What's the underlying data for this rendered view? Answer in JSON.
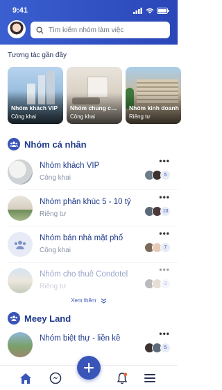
{
  "status": {
    "time": "9:41"
  },
  "search": {
    "placeholder": "Tìm kiếm nhóm làm việc"
  },
  "recent": {
    "title": "Tương tác gần đây",
    "cards": [
      {
        "name": "Nhóm khách VIP",
        "privacy": "Công khai"
      },
      {
        "name": "Nhóm chung cư...",
        "privacy": "Công khai"
      },
      {
        "name": "Nhóm kinh doanh",
        "privacy": "Riêng tư"
      }
    ]
  },
  "personal": {
    "title": "Nhóm cá nhân",
    "groups": [
      {
        "name": "Nhóm khách VIP",
        "privacy": "Công khai",
        "count": "5"
      },
      {
        "name": "Nhóm phân khúc 5 - 10 tỷ",
        "privacy": "Riêng tư",
        "count": "10"
      },
      {
        "name": "Nhóm bán nhà mặt phố",
        "privacy": "Công khai",
        "count": "7"
      },
      {
        "name": "Nhóm cho thuê Condotel",
        "privacy": "Riêng tư",
        "count": "3"
      }
    ],
    "see_more": "Xem thêm"
  },
  "meey": {
    "title": "Meey Land",
    "groups": [
      {
        "name": "Nhóm biệt thự - liền kề",
        "privacy": "",
        "count": "5"
      }
    ]
  },
  "more_label": "•••",
  "colors": {
    "primary": "#3a55b8",
    "header": "#2f4fc2"
  }
}
